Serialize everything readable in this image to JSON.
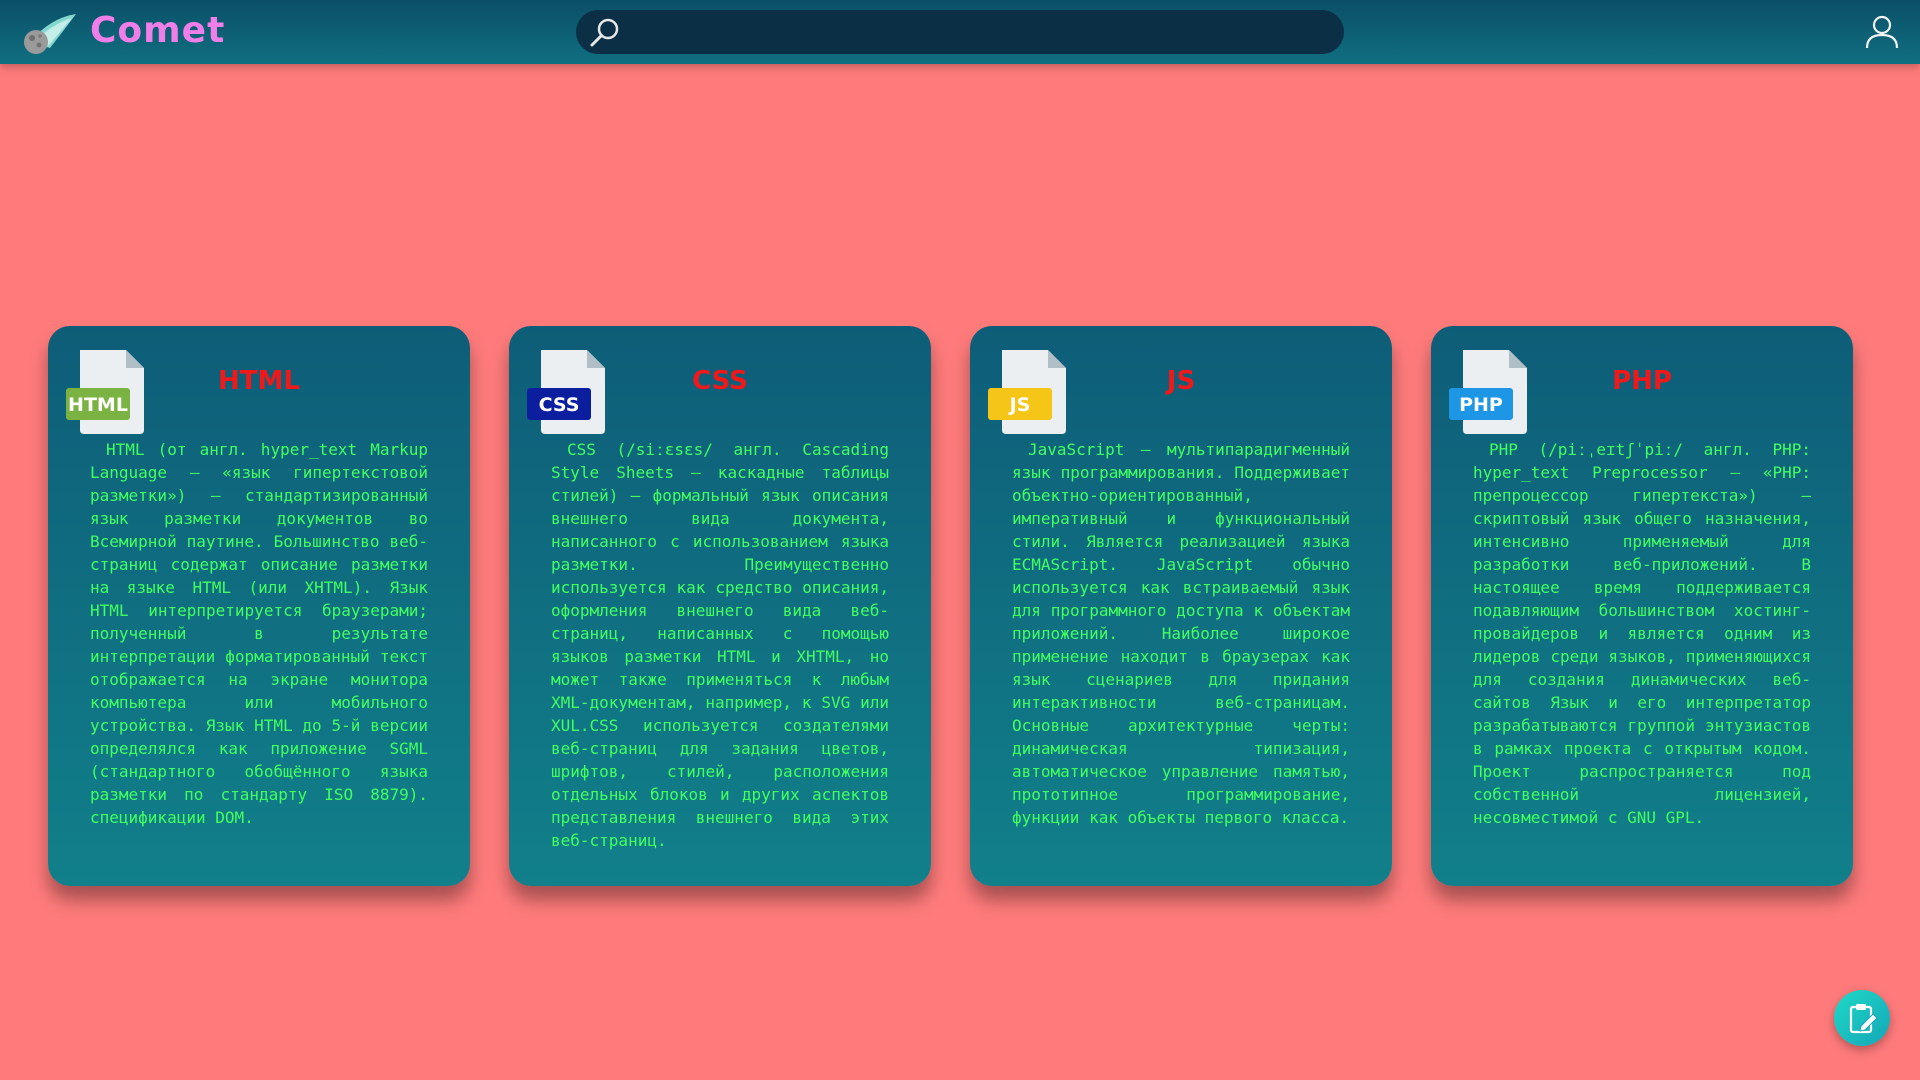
{
  "header": {
    "brand": "Comet",
    "search_placeholder": ""
  },
  "cards": [
    {
      "badge": "HTML",
      "title": "HTML",
      "text": "HTML (от англ. hyper_text Markup Language — «язык гипертекстовой разметки») — стандартизированный язык разметки документов во Всемирной паутине. Большинство веб-страниц содержат описание разметки на языке HTML (или XHTML). Язык HTML интерпретируется браузерами; полученный в результате интерпретации форматированный текст отображается на экране монитора компьютера или мобильного устройства. Язык HTML до 5-й версии определялся как приложение SGML (стандартного обобщённого языка разметки по стандарту ISO 8879). спецификации DOM."
    },
    {
      "badge": "CSS",
      "title": "CSS",
      "text": "CSS (/siːɛsɛs/ англ. Cascading Style Sheets — каскадные таблицы стилей) — формальный язык описания внешнего вида документа, написанного с использованием языка разметки. Преимущественно используется как средство описания, оформления внешнего вида веб-страниц, написанных с помощью языков разметки HTML и XHTML, но может также применяться к любым XML-документам, например, к SVG или XUL.CSS используется создателями веб-страниц для задания цветов, шрифтов, стилей, расположения отдельных блоков и других аспектов представления внешнего вида этих веб-страниц."
    },
    {
      "badge": "JS",
      "title": "JS",
      "text": "JavaScript — мультипарадигменный язык программирования. Поддерживает объектно-ориентированный, императивный и функциональный стили. Является реализацией языка ECMAScript. JavaScript обычно используется как встраиваемый язык для программного доступа к объектам приложений. Наиболее широкое применение находит в браузерах как язык сценариев для придания интерактивности веб-страницам. Основные архитектурные черты: динамическая типизация, автоматическое управление памятью, прототипное программирование, функции как объекты первого класса."
    },
    {
      "badge": "PHP",
      "title": "PHP",
      "text": "PHP (/piːˌeɪtʃˈpiː/ англ. PHP: hyper_text Preprocessor — «PHP: препроцессор гипертекста») — скриптовый язык общего назначения, интенсивно применяемый для разработки веб-приложений. В настоящее время поддерживается подавляющим большинством хостинг-провайдеров и является одним из лидеров среди языков, применяющихся для создания динамических веб-сайтов Язык и его интерпретатор разрабатываются группой энтузиастов в рамках проекта с открытым кодом. Проект распространяется под собственной лицензией, несовместимой с GNU GPL."
    }
  ],
  "colors": {
    "page_background": "#ff7b7b",
    "header_background": "#0e5f74",
    "brand_color": "#f07ee8",
    "card_title": "#f01818",
    "card_text": "#42ff5e",
    "badge_html": "#7bb342",
    "badge_css": "#0b1f9e",
    "badge_js": "#f5c518",
    "badge_php": "#1e96e6"
  },
  "icons": {
    "logo": "comet-logo-icon",
    "search": "search-icon",
    "user": "user-icon",
    "fab": "clipboard-edit-icon",
    "file": "file-icon"
  }
}
